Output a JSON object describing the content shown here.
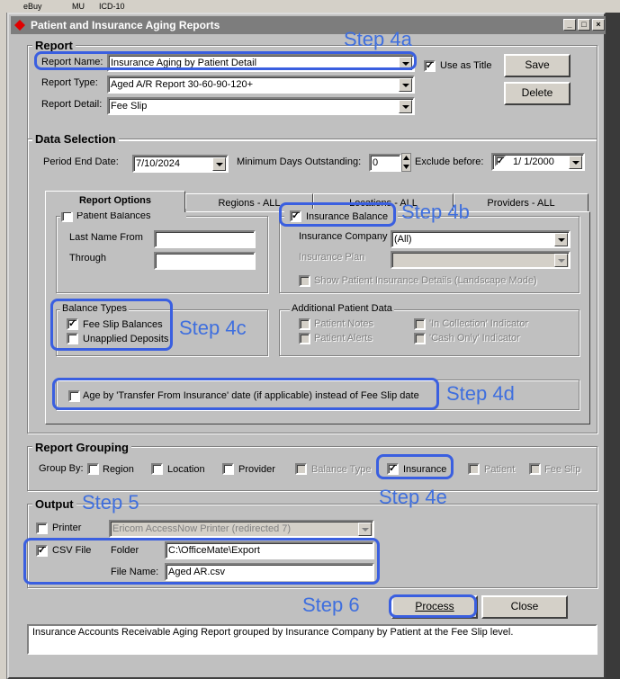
{
  "background": {
    "tabs": [
      "eBuy",
      "MU",
      "ICD-10"
    ]
  },
  "window": {
    "title": "Patient and Insurance Aging Reports",
    "controls": [
      "minimize",
      "maximize",
      "close"
    ]
  },
  "report": {
    "legend": "Report",
    "name_label": "Report Name:",
    "name_value": "Insurance Aging by Patient Detail",
    "type_label": "Report Type:",
    "type_value": "Aged A/R Report 30-60-90-120+",
    "detail_label": "Report Detail:",
    "detail_value": "Fee Slip",
    "use_as_title_label": "Use as Title",
    "use_as_title_checked": true,
    "save_label": "Save",
    "delete_label": "Delete"
  },
  "data_selection": {
    "legend": "Data Selection",
    "period_end_label": "Period End Date:",
    "period_end_value": "7/10/2024",
    "min_days_label": "Minimum Days Outstanding:",
    "min_days_value": "0",
    "exclude_before_label": "Exclude before:",
    "exclude_before_checked": true,
    "exclude_before_value": "1/  1/2000",
    "tabs": [
      "Report Options",
      "Regions - ALL",
      "Locations - ALL",
      "Providers - ALL"
    ],
    "active_tab": "Report Options",
    "patient_balances_label": "Patient Balances",
    "patient_balances_checked": false,
    "last_name_from_label": "Last Name From",
    "through_label": "Through",
    "insurance_balance_label": "Insurance Balance",
    "insurance_balance_checked": true,
    "insurance_company_label": "Insurance Company",
    "insurance_company_value": "(All)",
    "insurance_plan_label": "Insurance Plan",
    "show_details_label": "Show Patient Insurance Details (Landscape Mode)",
    "balance_types_legend": "Balance Types",
    "fee_slip_balances_label": "Fee Slip Balances",
    "fee_slip_balances_checked": true,
    "unapplied_deposits_label": "Unapplied Deposits",
    "unapplied_deposits_checked": false,
    "additional_legend": "Additional Patient Data",
    "patient_notes_label": "Patient Notes",
    "patient_alerts_label": "Patient Alerts",
    "in_collection_label": "'In Collection' Indicator",
    "cash_only_label": "'Cash Only' Indicator",
    "age_by_transfer_label": "Age by 'Transfer From Insurance' date (if applicable) instead of Fee Slip date",
    "age_by_transfer_checked": false
  },
  "report_grouping": {
    "legend": "Report Grouping",
    "group_by_label": "Group By:",
    "options": [
      {
        "label": "Region",
        "checked": false,
        "enabled": true
      },
      {
        "label": "Location",
        "checked": false,
        "enabled": true
      },
      {
        "label": "Provider",
        "checked": false,
        "enabled": true
      },
      {
        "label": "Balance Type",
        "checked": false,
        "enabled": false
      },
      {
        "label": "Insurance",
        "checked": true,
        "enabled": true
      },
      {
        "label": "Patient",
        "checked": false,
        "enabled": false
      },
      {
        "label": "Fee Slip",
        "checked": false,
        "enabled": false
      }
    ]
  },
  "output": {
    "legend": "Output",
    "printer_label": "Printer",
    "printer_checked": false,
    "printer_value": "Ericom AccessNow Printer (redirected 7)",
    "csv_label": "CSV File",
    "csv_checked": true,
    "folder_label": "Folder",
    "folder_value": "C:\\OfficeMate\\Export",
    "file_name_label": "File Name:",
    "file_name_value": "Aged AR.csv"
  },
  "actions": {
    "process_label": "Process",
    "close_label": "Close"
  },
  "status_text": "Insurance Accounts Receivable Aging Report grouped by Insurance Company by Patient at the Fee Slip level.",
  "annotations": {
    "step_4a": "Step 4a",
    "step_4b": "Step 4b",
    "step_4c": "Step 4c",
    "step_4d": "Step 4d",
    "step_4e": "Step 4e",
    "step_5": "Step 5",
    "step_6": "Step 6",
    "color": "#3a5fe0"
  },
  "colors": {
    "dialog_bg": "#c0c0c0",
    "titlebar_bg": "#7d7d7d",
    "annotation_blue": "#3a5fe0",
    "app_icon_red": "#e00000"
  }
}
